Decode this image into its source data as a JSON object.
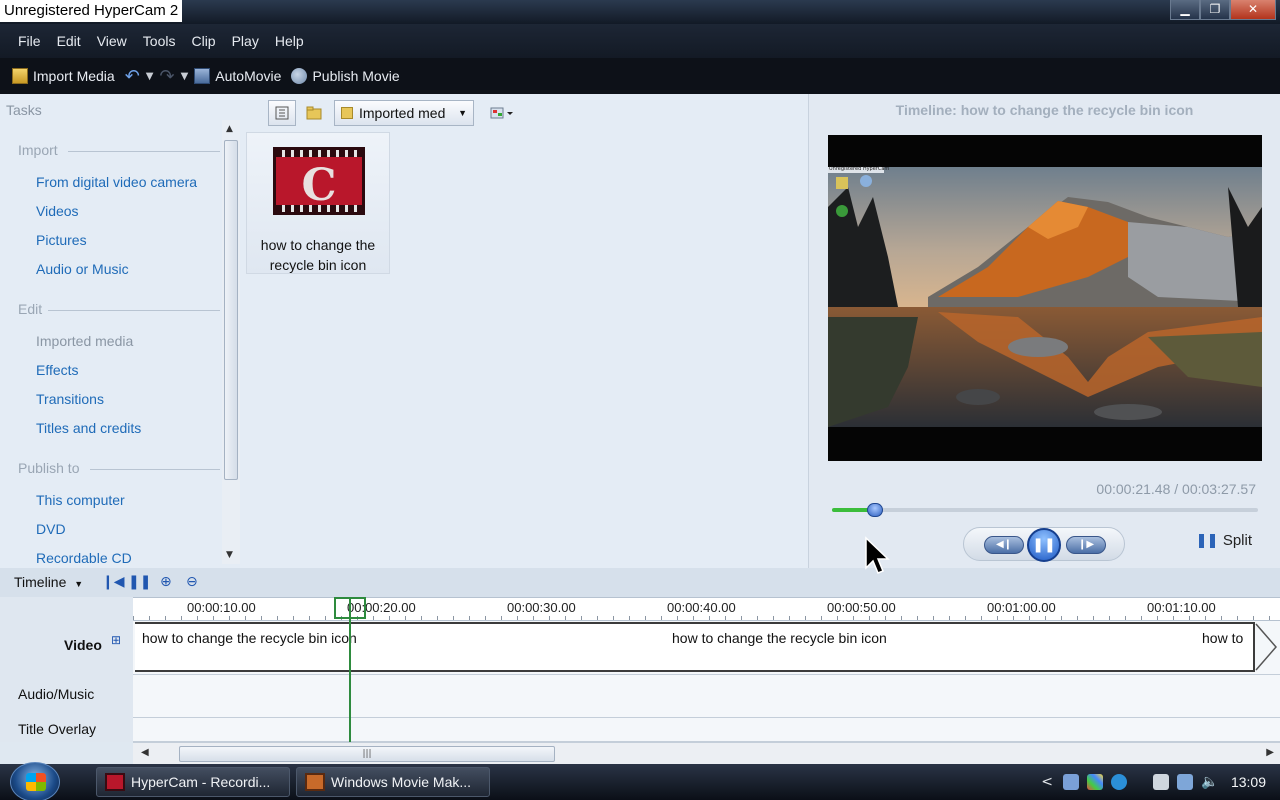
{
  "window": {
    "title": "Unregistered HyperCam 2",
    "controls": [
      "minimize",
      "restore",
      "close"
    ]
  },
  "menu": [
    "File",
    "Edit",
    "View",
    "Tools",
    "Clip",
    "Play",
    "Help"
  ],
  "toolbar": {
    "import_media": "Import Media",
    "automovie": "AutoMovie",
    "publish_movie": "Publish Movie"
  },
  "tasks": {
    "header": "Tasks",
    "import": {
      "title": "Import",
      "items": [
        "From digital video camera",
        "Videos",
        "Pictures",
        "Audio or Music"
      ]
    },
    "edit": {
      "title": "Edit",
      "items": [
        "Imported media",
        "Effects",
        "Transitions",
        "Titles and credits"
      ]
    },
    "publish": {
      "title": "Publish to",
      "items": [
        "This computer",
        "DVD",
        "Recordable CD"
      ]
    }
  },
  "collection": {
    "dropdown": "Imported med",
    "clip_label": "how to change the recycle bin icon",
    "clip_glyph": "C"
  },
  "preview": {
    "title": "Timeline: how to change the recycle bin icon",
    "time": "00:00:21.48 / 00:03:27.57",
    "progress": 0.1,
    "split": "Split",
    "desktop_title": "Unregistered HyperCam"
  },
  "timeline": {
    "label": "Timeline",
    "ticks": [
      "00:00:10.00",
      "00:00:20.00",
      "00:00:30.00",
      "00:00:40.00",
      "00:00:50.00",
      "00:01:00.00",
      "00:01:10.00"
    ],
    "tracks": {
      "video": "Video",
      "audio": "Audio/Music",
      "title_overlay": "Title Overlay"
    },
    "video_clip_texts": [
      "how to change the recycle bin icon",
      "how to change the recycle bin icon",
      "how to"
    ]
  },
  "taskbar": {
    "buttons": [
      "HyperCam - Recordi...",
      "Windows Movie Mak..."
    ],
    "clock": "13:09"
  }
}
